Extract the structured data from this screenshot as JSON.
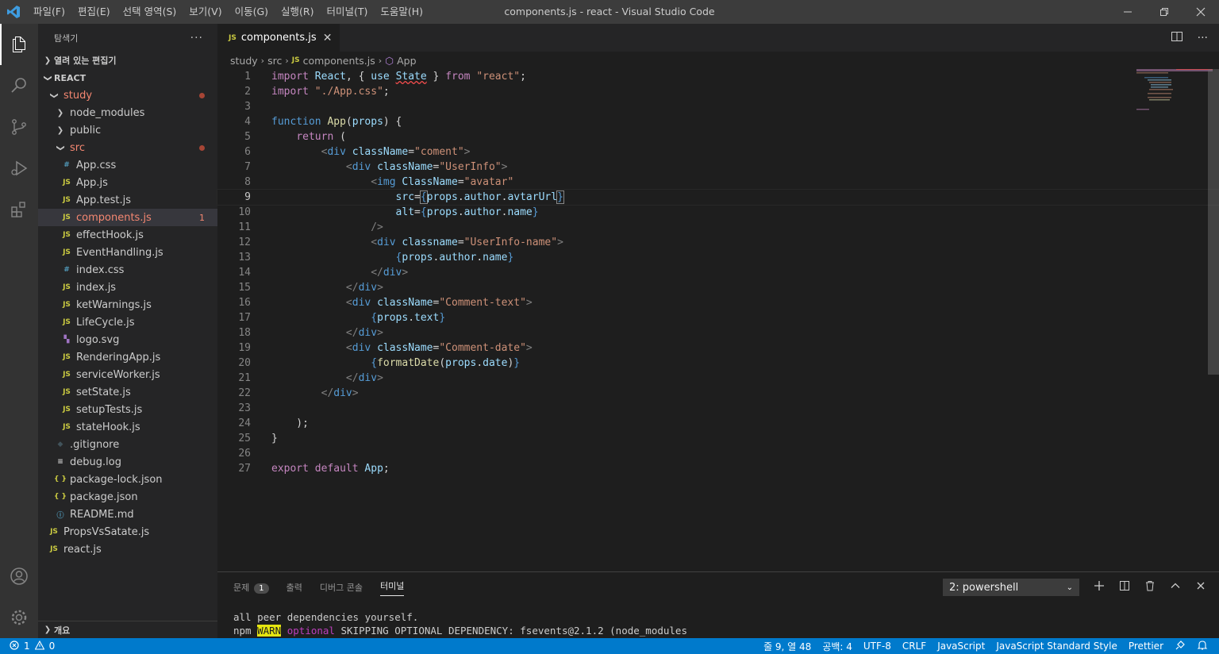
{
  "window": {
    "title": "components.js - react - Visual Studio Code",
    "menu": [
      "파일(F)",
      "편집(E)",
      "선택 영역(S)",
      "보기(V)",
      "이동(G)",
      "실행(R)",
      "터미널(T)",
      "도움말(H)"
    ]
  },
  "sidebar": {
    "title": "탐색기",
    "open_editors": "열려 있는 편집기",
    "root": "REACT",
    "outline": "개요",
    "items": [
      {
        "label": "study",
        "type": "folder-open",
        "indent": 1,
        "modified": true,
        "dot": true
      },
      {
        "label": "node_modules",
        "type": "folder",
        "indent": 2
      },
      {
        "label": "public",
        "type": "folder",
        "indent": 2
      },
      {
        "label": "src",
        "type": "folder-open",
        "indent": 2,
        "modified": true,
        "dot": true
      },
      {
        "label": "App.css",
        "type": "css",
        "indent": 3
      },
      {
        "label": "App.js",
        "type": "js",
        "indent": 3
      },
      {
        "label": "App.test.js",
        "type": "js",
        "indent": 3
      },
      {
        "label": "components.js",
        "type": "js",
        "indent": 3,
        "modified": true,
        "selected": true,
        "count": "1"
      },
      {
        "label": "effectHook.js",
        "type": "js",
        "indent": 3
      },
      {
        "label": "EventHandling.js",
        "type": "js",
        "indent": 3
      },
      {
        "label": "index.css",
        "type": "css",
        "indent": 3
      },
      {
        "label": "index.js",
        "type": "js",
        "indent": 3
      },
      {
        "label": "ketWarnings.js",
        "type": "js",
        "indent": 3
      },
      {
        "label": "LifeCycle.js",
        "type": "js",
        "indent": 3
      },
      {
        "label": "logo.svg",
        "type": "svg",
        "indent": 3
      },
      {
        "label": "RenderingApp.js",
        "type": "js",
        "indent": 3
      },
      {
        "label": "serviceWorker.js",
        "type": "js",
        "indent": 3
      },
      {
        "label": "setState.js",
        "type": "js",
        "indent": 3
      },
      {
        "label": "setupTests.js",
        "type": "js",
        "indent": 3
      },
      {
        "label": "stateHook.js",
        "type": "js",
        "indent": 3
      },
      {
        "label": ".gitignore",
        "type": "git",
        "indent": 2
      },
      {
        "label": "debug.log",
        "type": "log",
        "indent": 2
      },
      {
        "label": "package-lock.json",
        "type": "json",
        "indent": 2
      },
      {
        "label": "package.json",
        "type": "json",
        "indent": 2
      },
      {
        "label": "README.md",
        "type": "info",
        "indent": 2
      },
      {
        "label": "PropsVsSatate.js",
        "type": "js",
        "indent": 1
      },
      {
        "label": "react.js",
        "type": "js",
        "indent": 1
      }
    ]
  },
  "editor": {
    "tab": "components.js",
    "breadcrumb": [
      "study",
      "src",
      "components.js",
      "App"
    ]
  },
  "panel": {
    "tabs": [
      "문제",
      "출력",
      "디버그 콘솔",
      "터미널"
    ],
    "problem_count": "1",
    "active_tab": "터미널",
    "terminal_select": "2: powershell",
    "terminal_line1": "all peer dependencies yourself.",
    "terminal_line2_prefix": "npm ",
    "terminal_warn": "WARN",
    "terminal_optional": "optional",
    "terminal_line2_rest": " SKIPPING OPTIONAL DEPENDENCY: fsevents@2.1.2 (node_modules"
  },
  "status": {
    "errors": "1",
    "warnings": "0",
    "position": "줄 9, 열 48",
    "spaces": "공백: 4",
    "encoding": "UTF-8",
    "eol": "CRLF",
    "language": "JavaScript",
    "linter": "JavaScript Standard Style",
    "formatter": "Prettier"
  },
  "colors": {
    "accent": "#007acc",
    "titlebar": "#3c3c3c",
    "activitybar": "#333333",
    "sidebar": "#252526",
    "editor": "#1e1e1e"
  }
}
